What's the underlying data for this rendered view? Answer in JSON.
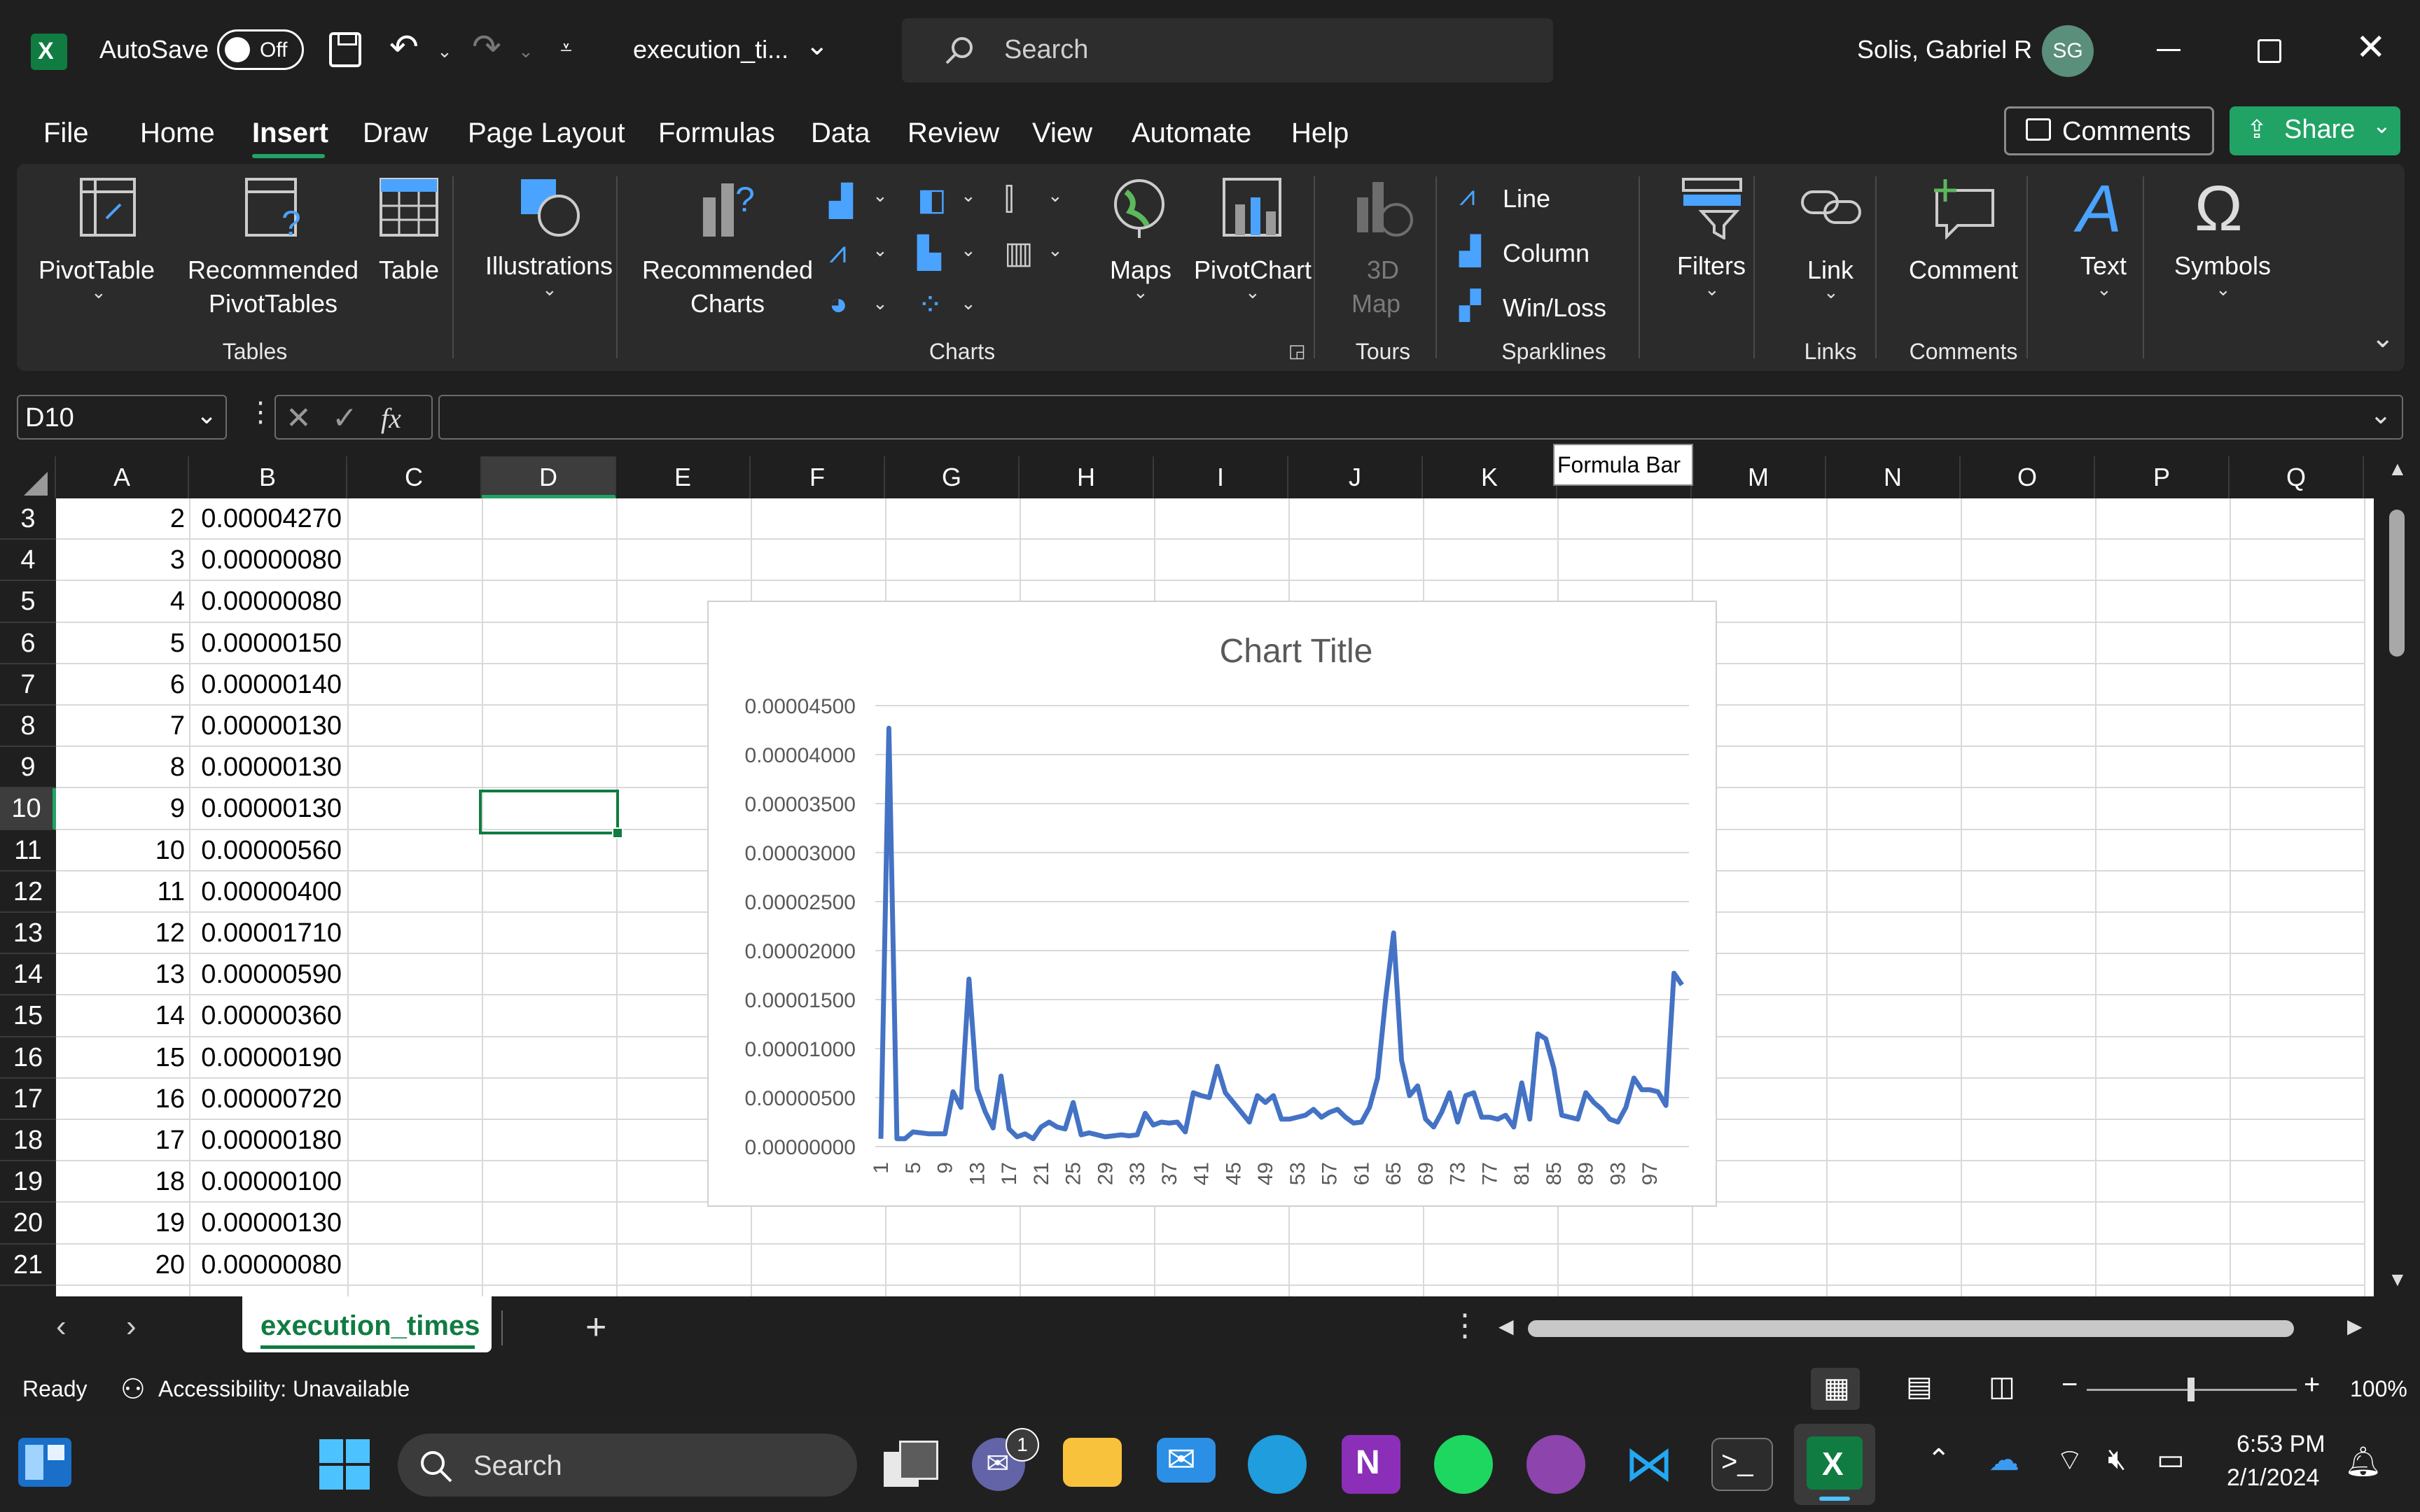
{
  "titlebar": {
    "autosave_label": "AutoSave",
    "autosave_state": "Off",
    "filename": "execution_ti...",
    "search_placeholder": "Search",
    "user_name": "Solis, Gabriel R",
    "user_initials": "SG"
  },
  "menu": {
    "tabs": [
      "File",
      "Home",
      "Insert",
      "Draw",
      "Page Layout",
      "Formulas",
      "Data",
      "Review",
      "View",
      "Automate",
      "Help"
    ],
    "active": "Insert",
    "comments_label": "Comments",
    "share_label": "Share"
  },
  "ribbon": {
    "pivottable": "PivotTable",
    "recommended_pivot_1": "Recommended",
    "recommended_pivot_2": "PivotTables",
    "table": "Table",
    "group_tables": "Tables",
    "illustrations": "Illustrations",
    "recommended_charts_1": "Recommended",
    "recommended_charts_2": "Charts",
    "maps": "Maps",
    "pivotchart": "PivotChart",
    "group_charts": "Charts",
    "map3d_1": "3D",
    "map3d_2": "Map",
    "group_tours": "Tours",
    "spark_line": "Line",
    "spark_column": "Column",
    "spark_winloss": "Win/Loss",
    "group_sparklines": "Sparklines",
    "filters": "Filters",
    "link": "Link",
    "group_links": "Links",
    "comment": "Comment",
    "group_comments": "Comments",
    "text": "Text",
    "symbols": "Symbols"
  },
  "formula": {
    "name_box": "D10",
    "fx": "fx",
    "tooltip": "Formula Bar",
    "content": ""
  },
  "grid": {
    "columns": [
      "A",
      "B",
      "C",
      "D",
      "E",
      "F",
      "G",
      "H",
      "I",
      "J",
      "K",
      "L",
      "M",
      "N",
      "O",
      "P",
      "Q"
    ],
    "selected_column": "D",
    "selected_row": "10",
    "rows": [
      {
        "row": "3",
        "a": "2",
        "b": "0.00004270"
      },
      {
        "row": "4",
        "a": "3",
        "b": "0.00000080"
      },
      {
        "row": "5",
        "a": "4",
        "b": "0.00000080"
      },
      {
        "row": "6",
        "a": "5",
        "b": "0.00000150"
      },
      {
        "row": "7",
        "a": "6",
        "b": "0.00000140"
      },
      {
        "row": "8",
        "a": "7",
        "b": "0.00000130"
      },
      {
        "row": "9",
        "a": "8",
        "b": "0.00000130"
      },
      {
        "row": "10",
        "a": "9",
        "b": "0.00000130"
      },
      {
        "row": "11",
        "a": "10",
        "b": "0.00000560"
      },
      {
        "row": "12",
        "a": "11",
        "b": "0.00000400"
      },
      {
        "row": "13",
        "a": "12",
        "b": "0.00001710"
      },
      {
        "row": "14",
        "a": "13",
        "b": "0.00000590"
      },
      {
        "row": "15",
        "a": "14",
        "b": "0.00000360"
      },
      {
        "row": "16",
        "a": "15",
        "b": "0.00000190"
      },
      {
        "row": "17",
        "a": "16",
        "b": "0.00000720"
      },
      {
        "row": "18",
        "a": "17",
        "b": "0.00000180"
      },
      {
        "row": "19",
        "a": "18",
        "b": "0.00000100"
      },
      {
        "row": "20",
        "a": "19",
        "b": "0.00000130"
      },
      {
        "row": "21",
        "a": "20",
        "b": "0.00000080"
      }
    ]
  },
  "chart_data": {
    "type": "line",
    "title": "Chart Title",
    "xlabel": "",
    "ylabel": "",
    "ylim": [
      0,
      4.5e-05
    ],
    "yticks": [
      "0.00000000",
      "0.00000500",
      "0.00001000",
      "0.00001500",
      "0.00002000",
      "0.00002500",
      "0.00003000",
      "0.00003500",
      "0.00004000",
      "0.00004500"
    ],
    "xticks": [
      "1",
      "5",
      "9",
      "13",
      "17",
      "21",
      "25",
      "29",
      "33",
      "37",
      "41",
      "45",
      "49",
      "53",
      "57",
      "61",
      "65",
      "69",
      "73",
      "77",
      "81",
      "85",
      "89",
      "93",
      "97"
    ],
    "grid": true,
    "color": "#4472c4",
    "series": [
      {
        "values": [
          8e-07,
          4.27e-05,
          8e-07,
          8e-07,
          1.5e-06,
          1.4e-06,
          1.3e-06,
          1.3e-06,
          1.3e-06,
          5.6e-06,
          4e-06,
          1.71e-05,
          5.9e-06,
          3.6e-06,
          1.9e-06,
          7.2e-06,
          1.8e-06,
          1e-06,
          1.3e-06,
          8e-07,
          2e-06,
          2.5e-06,
          2e-06,
          1.8e-06,
          4.5e-06,
          1.2e-06,
          1.4e-06,
          1.2e-06,
          1e-06,
          1.1e-06,
          1.2e-06,
          1.1e-06,
          1.2e-06,
          3.4e-06,
          2.2e-06,
          2.5e-06,
          2.4e-06,
          2.5e-06,
          1.5e-06,
          5.5e-06,
          5.2e-06,
          5e-06,
          8.2e-06,
          5.5e-06,
          4.5e-06,
          3.5e-06,
          2.5e-06,
          5.2e-06,
          4.5e-06,
          5.2e-06,
          2.8e-06,
          2.8e-06,
          3e-06,
          3.2e-06,
          3.8e-06,
          3e-06,
          3.5e-06,
          3.8e-06,
          3e-06,
          2.4e-06,
          2.5e-06,
          4e-06,
          7e-06,
          1.5e-05,
          2.18e-05,
          8.8e-06,
          5.2e-06,
          6.2e-06,
          2.8e-06,
          2e-06,
          3.5e-06,
          5.5e-06,
          2.5e-06,
          5.2e-06,
          5.5e-06,
          3e-06,
          3e-06,
          2.8e-06,
          3.2e-06,
          2e-06,
          6.5e-06,
          2.8e-06,
          1.15e-05,
          1.1e-05,
          8e-06,
          3.2e-06,
          3e-06,
          2.8e-06,
          5.5e-06,
          4.5e-06,
          3.8e-06,
          2.8e-06,
          2.5e-06,
          4e-06,
          7e-06,
          5.8e-06,
          5.8e-06,
          5.6e-06,
          4.2e-06,
          1.77e-05,
          1.65e-05
        ]
      }
    ]
  },
  "sheet_tabs": {
    "active": "execution_times"
  },
  "status": {
    "ready": "Ready",
    "accessibility": "Accessibility: Unavailable",
    "zoom": "100%"
  },
  "taskbar": {
    "search": "Search",
    "time": "6:53 PM",
    "date": "2/1/2024",
    "teams_badge": "1"
  }
}
